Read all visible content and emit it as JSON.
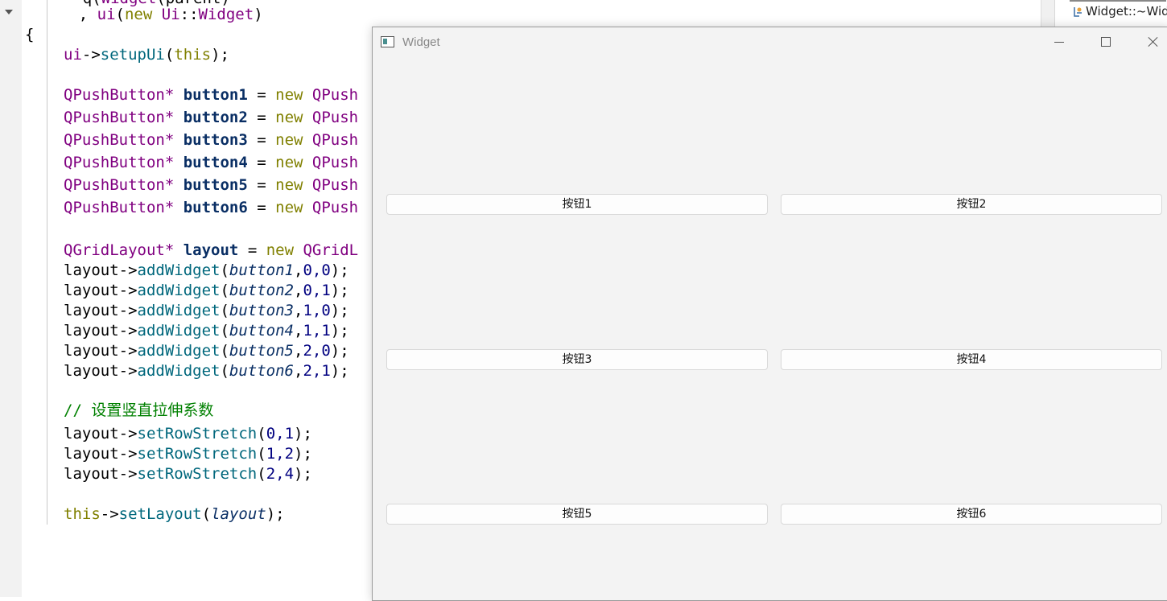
{
  "editor": {
    "partial_top": ", ui(new Ui::Widget)",
    "lines": [
      {
        "kind": "brace",
        "text": "{"
      },
      {
        "kind": "setup",
        "obj": "ui",
        "arrow": "->",
        "fn": "setupUi",
        "open": "(",
        "arg": "this",
        "close": ");"
      },
      {
        "kind": "decl",
        "type": "QPushButton*",
        "var": "button1",
        "eq": "=",
        "kw": "new",
        "cls": "QPush"
      },
      {
        "kind": "decl",
        "type": "QPushButton*",
        "var": "button2",
        "eq": "=",
        "kw": "new",
        "cls": "QPush"
      },
      {
        "kind": "decl",
        "type": "QPushButton*",
        "var": "button3",
        "eq": "=",
        "kw": "new",
        "cls": "QPush"
      },
      {
        "kind": "decl",
        "type": "QPushButton*",
        "var": "button4",
        "eq": "=",
        "kw": "new",
        "cls": "QPush"
      },
      {
        "kind": "decl",
        "type": "QPushButton*",
        "var": "button5",
        "eq": "=",
        "kw": "new",
        "cls": "QPush"
      },
      {
        "kind": "decl",
        "type": "QPushButton*",
        "var": "button6",
        "eq": "=",
        "kw": "new",
        "cls": "QPush"
      },
      {
        "kind": "decl",
        "type": "QGridLayout*",
        "var": "layout",
        "eq": "=",
        "kw": "new",
        "cls": "QGridL"
      },
      {
        "kind": "call",
        "obj": "layout",
        "fn": "addWidget",
        "arg": "button1",
        "nums": "0,0"
      },
      {
        "kind": "call",
        "obj": "layout",
        "fn": "addWidget",
        "arg": "button2",
        "nums": "0,1"
      },
      {
        "kind": "call",
        "obj": "layout",
        "fn": "addWidget",
        "arg": "button3",
        "nums": "1,0"
      },
      {
        "kind": "call",
        "obj": "layout",
        "fn": "addWidget",
        "arg": "button4",
        "nums": "1,1"
      },
      {
        "kind": "call",
        "obj": "layout",
        "fn": "addWidget",
        "arg": "button5",
        "nums": "2,0"
      },
      {
        "kind": "call",
        "obj": "layout",
        "fn": "addWidget",
        "arg": "button6",
        "nums": "2,1"
      },
      {
        "kind": "comment",
        "text": "// 设置竖直拉伸系数"
      },
      {
        "kind": "stretch",
        "obj": "layout",
        "fn": "setRowStretch",
        "nums": "0,1"
      },
      {
        "kind": "stretch",
        "obj": "layout",
        "fn": "setRowStretch",
        "nums": "1,2"
      },
      {
        "kind": "stretch",
        "obj": "layout",
        "fn": "setRowStretch",
        "nums": "2,4"
      },
      {
        "kind": "setlayout",
        "obj": "this",
        "fn": "setLayout",
        "arg": "layout"
      }
    ]
  },
  "side_panel": {
    "item": "Widget::~Widget"
  },
  "window": {
    "title": "Widget",
    "buttons": [
      "按钮1",
      "按钮2",
      "按钮3",
      "按钮4",
      "按钮5",
      "按钮6"
    ]
  },
  "colors": {
    "keyword": "#808000",
    "type": "#800080",
    "function": "#00677c",
    "variable": "#092e64",
    "comment": "#008000"
  }
}
